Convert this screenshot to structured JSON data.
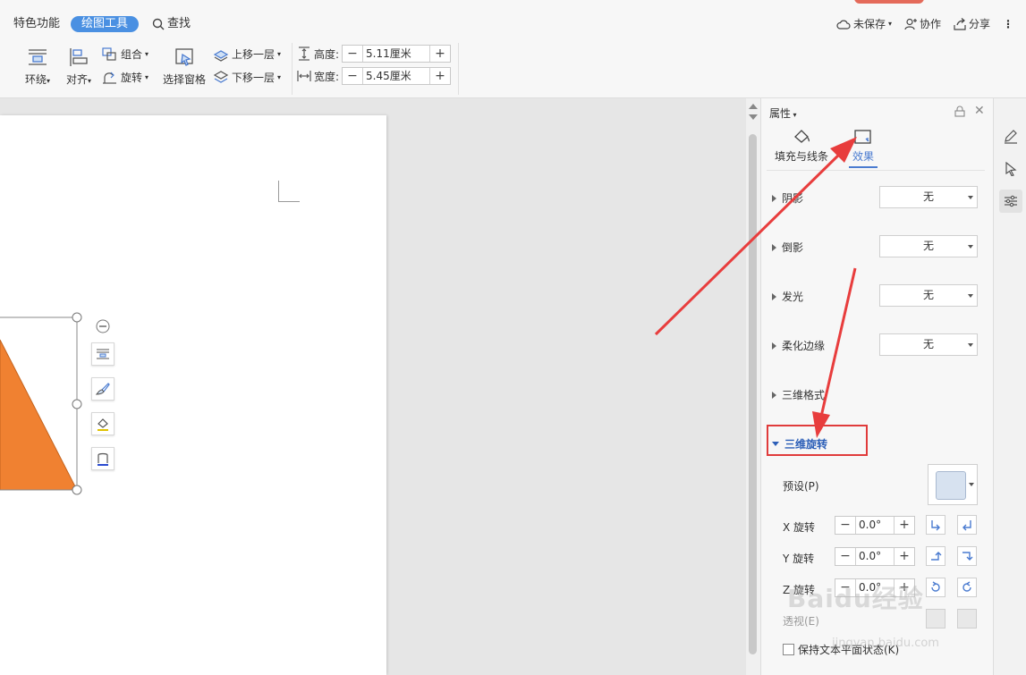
{
  "tabs": {
    "features": "特色功能",
    "drawing_tools": "绘图工具",
    "search": "查找"
  },
  "header_right": {
    "unsaved": "未保存",
    "collaborate": "协作",
    "share": "分享"
  },
  "ribbon": {
    "wrap": "环绕",
    "align": "对齐",
    "group": "组合",
    "rotate": "旋转",
    "selection_pane": "选择窗格",
    "bring_forward": "上移一层",
    "send_backward": "下移一层",
    "height_label": "高度:",
    "height_value": "5.11厘米",
    "width_label": "宽度:",
    "width_value": "5.45厘米"
  },
  "panel": {
    "title": "属性",
    "tab_fill_line": "填充与线条",
    "tab_effects": "效果",
    "sections": {
      "shadow": "阴影",
      "reflection": "倒影",
      "glow": "发光",
      "soft_edges": "柔化边缘",
      "format_3d": "三维格式",
      "rotation_3d": "三维旋转"
    },
    "none": "无",
    "preset_label": "预设(P)",
    "x_rotation": "X 旋转",
    "y_rotation": "Y 旋转",
    "z_rotation": "Z 旋转",
    "perspective": "透视(E)",
    "x_value": "0.0°",
    "y_value": "0.0°",
    "z_value": "0.0°",
    "keep_text_flat": "保持文本平面状态(K)"
  },
  "watermark": "Baidu经验",
  "watermark_url": "jingyan.baidu.com",
  "colors": {
    "accent": "#4a90e2",
    "shape_fill": "#f08131",
    "arrow": "#e83d3d"
  }
}
